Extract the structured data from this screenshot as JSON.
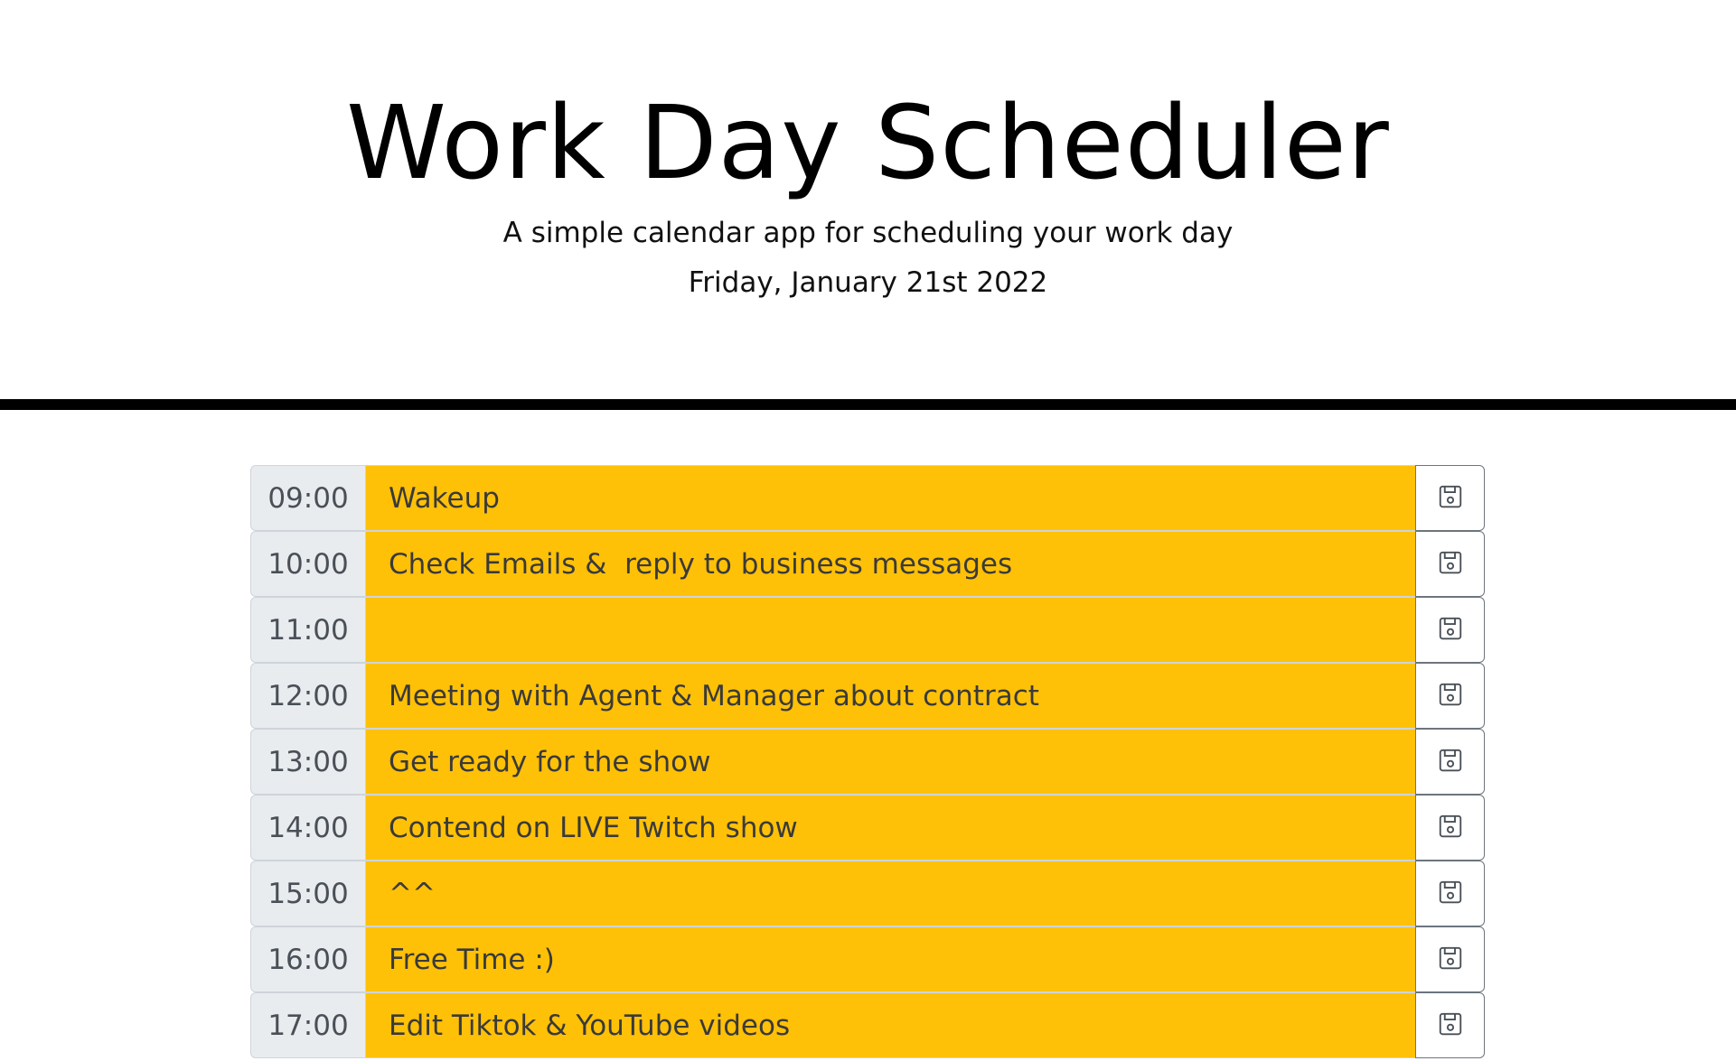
{
  "header": {
    "title": "Work Day Scheduler",
    "subtitle": "A simple calendar app for scheduling your work day",
    "current_day": "Friday, January 21st 2022"
  },
  "colors": {
    "present": "#ffc107",
    "hour_bg": "#e9ecef",
    "divider": "#000000"
  },
  "save_icon": "floppy-disk-icon",
  "time_blocks": [
    {
      "hour": "09:00",
      "text": "Wakeup"
    },
    {
      "hour": "10:00",
      "text": "Check Emails &  reply to business messages"
    },
    {
      "hour": "11:00",
      "text": ""
    },
    {
      "hour": "12:00",
      "text": "Meeting with Agent & Manager about contract"
    },
    {
      "hour": "13:00",
      "text": "Get ready for the show"
    },
    {
      "hour": "14:00",
      "text": "Contend on LIVE Twitch show"
    },
    {
      "hour": "15:00",
      "text": "^^"
    },
    {
      "hour": "16:00",
      "text": "Free Time :)"
    },
    {
      "hour": "17:00",
      "text": "Edit Tiktok & YouTube videos"
    }
  ]
}
